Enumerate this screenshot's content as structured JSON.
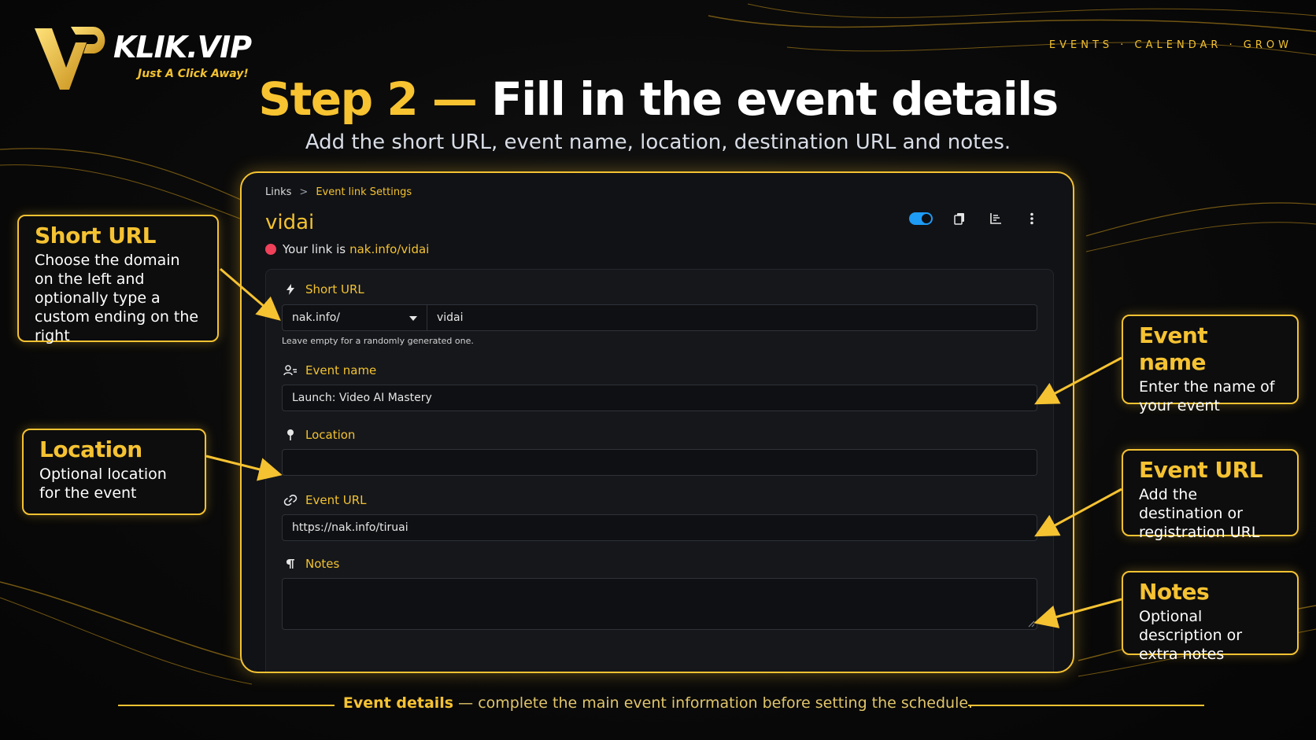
{
  "brand": {
    "name": "KLIK.VIP",
    "tagline": "Just A Click Away!"
  },
  "topnav": "EVENTS · CALENDAR · GROW",
  "title": {
    "step": "Step 2 —",
    "text": "Fill in the event details"
  },
  "subtitle": "Add the short URL, event name, location, destination URL and notes.",
  "breadcrumb": {
    "root": "Links",
    "separator": ">",
    "current": "Event link Settings"
  },
  "link": {
    "title": "vidai",
    "prefix": "Your link is",
    "url": "nak.info/vidai"
  },
  "actions": {
    "toggle_on": true,
    "toggle_color": "#1e9bf5",
    "icons": [
      "toggle-switch",
      "copy-icon",
      "stats-icon",
      "more-vertical-icon"
    ]
  },
  "form": {
    "short_url": {
      "label": "Short URL",
      "domain": "nak.info/",
      "slug": "vidai",
      "hint": "Leave empty for a randomly generated one."
    },
    "event_name": {
      "label": "Event name",
      "value": "Launch: Video AI Mastery"
    },
    "location": {
      "label": "Location",
      "value": ""
    },
    "event_url": {
      "label": "Event URL",
      "value": "https://nak.info/tiruai"
    },
    "notes": {
      "label": "Notes",
      "value": ""
    }
  },
  "callouts": {
    "short_url": {
      "title": "Short URL",
      "text": "Choose the domain on the left and optionally type a custom ending on the right"
    },
    "location": {
      "title": "Location",
      "text": "Optional location for the event"
    },
    "event_name": {
      "title": "Event name",
      "text": "Enter the name of your event"
    },
    "event_url": {
      "title": "Event URL",
      "text": "Add the destination or registration URL"
    },
    "notes": {
      "title": "Notes",
      "text": "Optional description or extra notes"
    }
  },
  "footer": {
    "bold": "Event details",
    "text": " — complete the main event information before setting the schedule."
  },
  "colors": {
    "accent": "#f5c232",
    "background": "#0a0a0a",
    "panel": "#111216",
    "status_dot": "#f0415a"
  }
}
